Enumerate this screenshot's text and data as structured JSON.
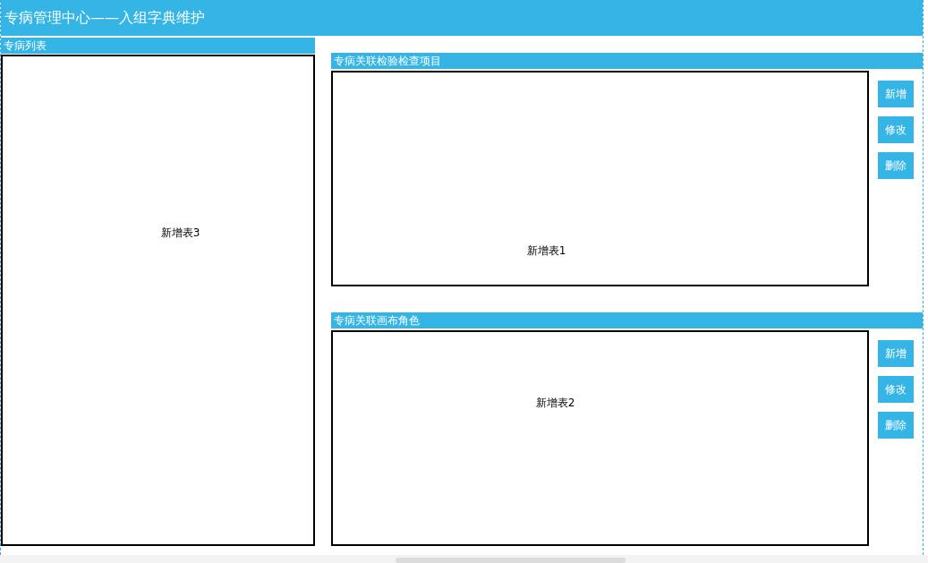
{
  "title": "专病管理中心——入组字典维护",
  "list_panel": {
    "header": "专病列表",
    "table_label": "新增表3"
  },
  "sections": [
    {
      "header": "专病关联检验检查项目",
      "table_label": "新增表1",
      "buttons": [
        "新增",
        "修改",
        "删除"
      ]
    },
    {
      "header": "专病关联画布角色",
      "table_label": "新增表2",
      "buttons": [
        "新增",
        "修改",
        "删除"
      ]
    }
  ]
}
